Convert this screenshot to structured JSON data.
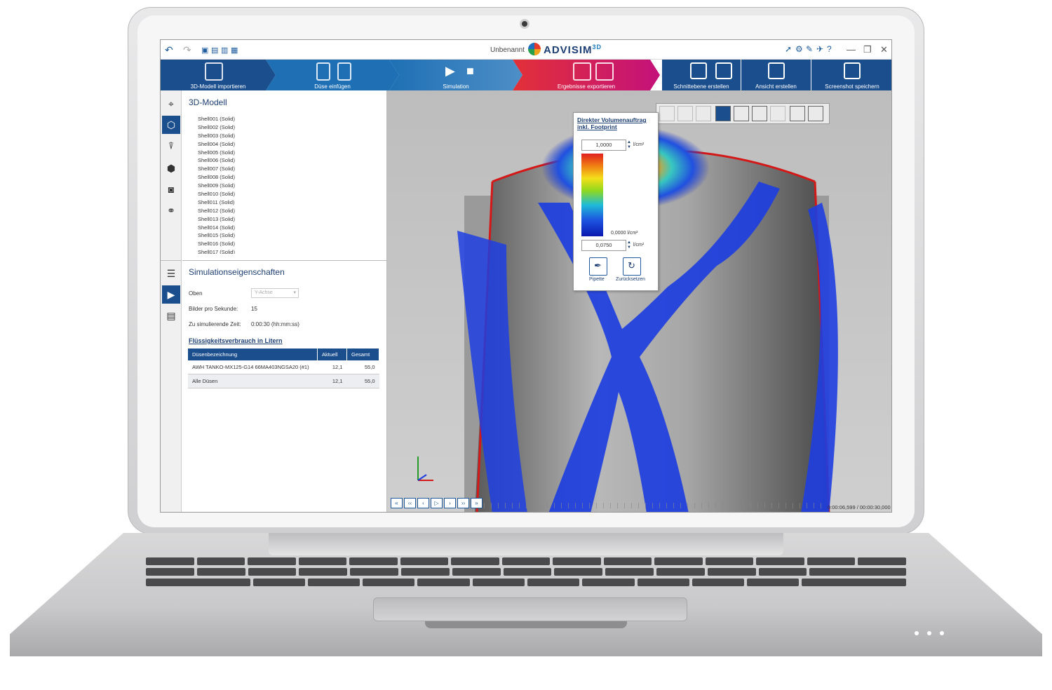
{
  "app": {
    "document_name": "Unbenannt",
    "logo_text": "ADVISIM",
    "logo_sup": "3D"
  },
  "ribbon": {
    "steps": [
      {
        "label": "3D-Modell importieren",
        "color": "#1b4e8d"
      },
      {
        "label": "Düse einfügen",
        "color": "#1e7bc0"
      },
      {
        "label": "Simulation",
        "color": "#3aa0a8"
      },
      {
        "label": "Ergebnisse exportieren",
        "color": "#d8254a"
      }
    ],
    "actions": [
      {
        "label": "Schnittebene erstellen"
      },
      {
        "label": "Ansicht erstellen"
      },
      {
        "label": "Screenshot speichern"
      }
    ]
  },
  "model_panel": {
    "title": "3D-Modell",
    "items": [
      "Shell001 (Solid)",
      "Shell002 (Solid)",
      "Shell003 (Solid)",
      "Shell004 (Solid)",
      "Shell005 (Solid)",
      "Shell006 (Solid)",
      "Shell007 (Solid)",
      "Shell008 (Solid)",
      "Shell009 (Solid)",
      "Shell010 (Solid)",
      "Shell011 (Solid)",
      "Shell012 (Solid)",
      "Shell013 (Solid)",
      "Shell014 (Solid)",
      "Shell015 (Solid)",
      "Shell016 (Solid)",
      "Shell017 (Solid)"
    ]
  },
  "sim_props": {
    "title": "Simulationseigenschaften",
    "top_label": "Oben",
    "top_value": "Y-Achse",
    "fps_label": "Bilder pro Sekunde:",
    "fps_value": "15",
    "time_label": "Zu simulierende Zeit:",
    "time_value": "0:00:30 (hh:mm:ss)"
  },
  "consumption": {
    "title": "Flüssigkeitsverbrauch in Litern",
    "headers": [
      "Düsenbezeichnung",
      "Aktuell",
      "Gesamt"
    ],
    "rows": [
      {
        "name": "AWH TANKO-MX125-G14 66MA403NGSA20 (#1)",
        "current": "12,1",
        "total": "55,0"
      },
      {
        "name": "Alle Düsen",
        "current": "12,1",
        "total": "55,0"
      }
    ]
  },
  "legend": {
    "title_line1": "Direkter Volumenauftrag",
    "title_line2": "inkl. Footprint",
    "max_value": "1,0000",
    "min_value": "0,0000 l/cm²",
    "threshold": "0,0750",
    "unit": "l/cm²",
    "pipette_label": "Pipette",
    "reset_label": "Zurücksetzen"
  },
  "player": {
    "timecode": "0:00:06,599  /  00:00:30,000"
  },
  "colors": {
    "primary": "#1b4e8d",
    "accent": "#1e7bc0",
    "red_edge": "#d41818"
  }
}
